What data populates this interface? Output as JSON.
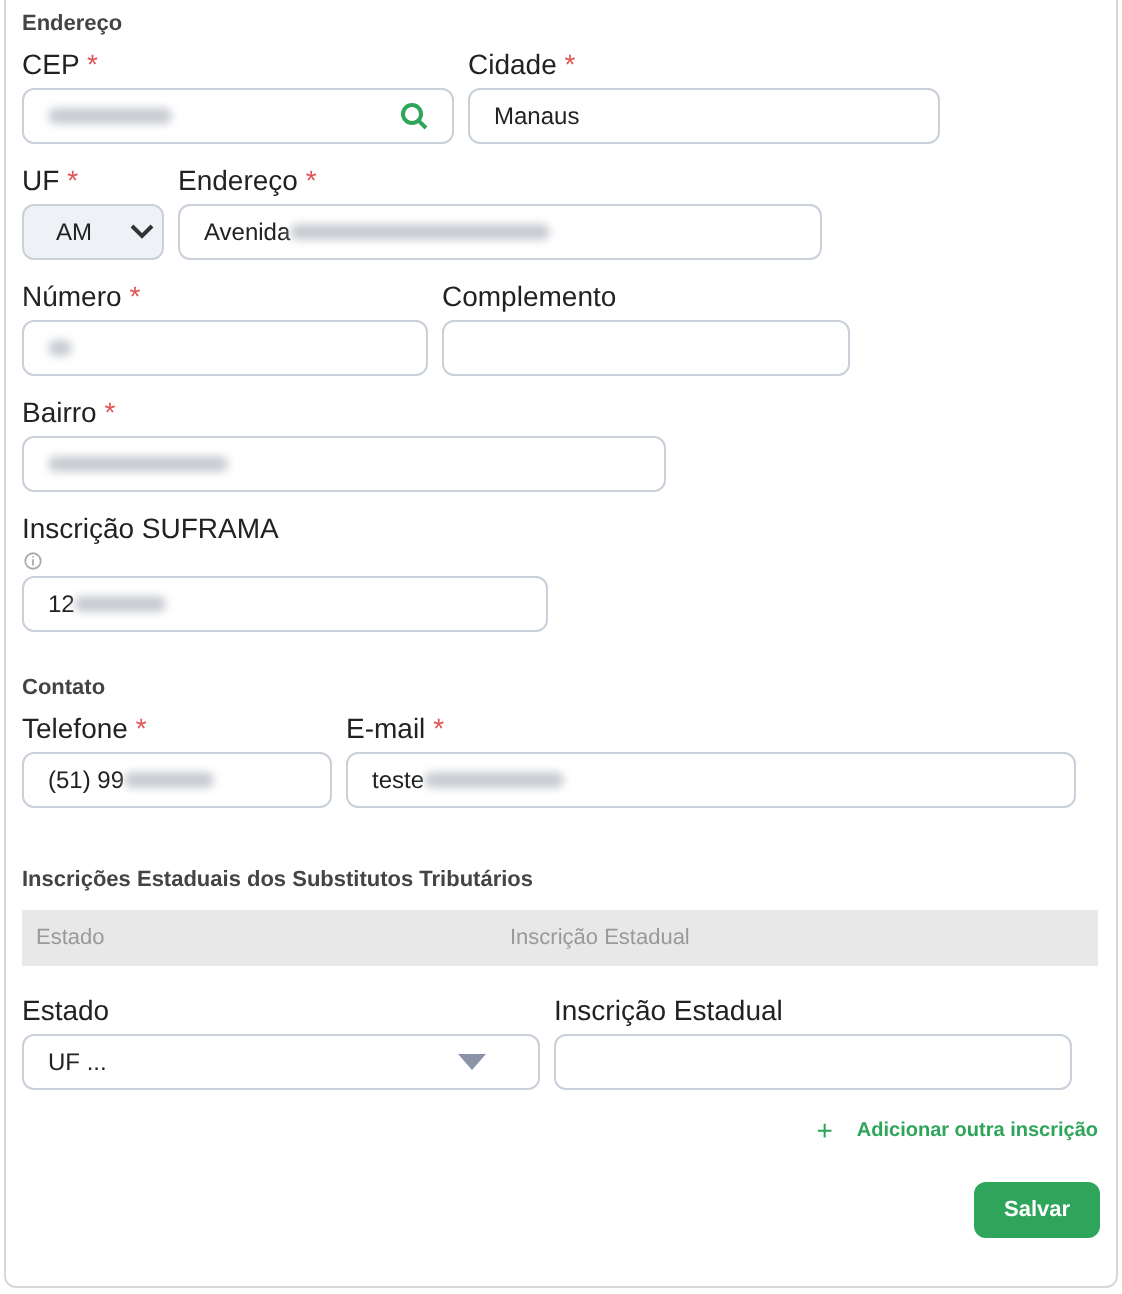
{
  "sections": [
    {
      "title": "Endereço",
      "rows": [
        [
          {
            "label": "CEP",
            "marker": "*",
            "kind": "search",
            "redacted": true
          },
          {
            "label": "Cidade",
            "marker": "*",
            "kind": "text",
            "value": "Manaus"
          }
        ],
        [
          {
            "label": "UF",
            "marker": "*",
            "kind": "select",
            "value": "AM"
          },
          {
            "label": "Endereço",
            "marker": "*",
            "kind": "text",
            "value": "Avenida",
            "redacted": true
          }
        ],
        [
          {
            "label": "Número",
            "marker": "*",
            "kind": "text",
            "redacted": true
          },
          {
            "label": "Complemento",
            "kind": "text"
          }
        ],
        [
          {
            "label": "Bairro",
            "marker": "*",
            "kind": "text",
            "redacted": true
          }
        ],
        [
          {
            "label": "Inscrição SUFRAMA",
            "kind": "text",
            "info": true,
            "value": "12",
            "redacted": true
          }
        ]
      ]
    },
    {
      "title": "Contato",
      "rows": [
        [
          {
            "label": "Telefone",
            "marker": "*",
            "kind": "text",
            "value": "(51) 99",
            "redacted": true
          },
          {
            "label": "E-mail",
            "marker": "*",
            "kind": "text",
            "value": "teste",
            "redacted": true
          }
        ]
      ]
    }
  ],
  "substitutes": {
    "title": "Inscrições Estaduais dos Substitutos Tributários",
    "columns": [
      "Estado",
      "Inscrição Estadual"
    ],
    "fields": [
      {
        "label": "Estado",
        "kind": "dropdown",
        "value": "UF ..."
      },
      {
        "label": "Inscrição Estadual",
        "kind": "text"
      }
    ],
    "add_link": {
      "icon": "+",
      "label": "Adicionar outra inscrição"
    }
  },
  "buttons": [
    "Salvar"
  ]
}
